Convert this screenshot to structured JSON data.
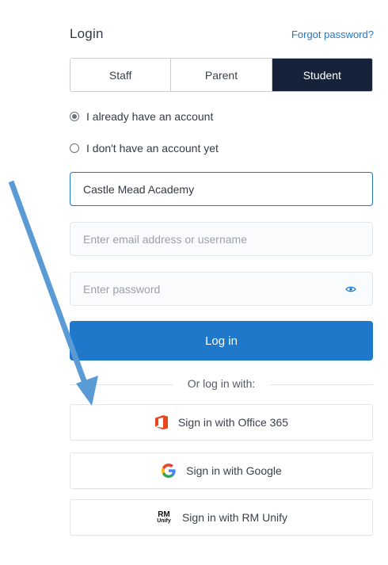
{
  "header": {
    "title": "Login",
    "forgot_password": "Forgot password?"
  },
  "account_types": [
    {
      "label": "Staff",
      "active": false
    },
    {
      "label": "Parent",
      "active": false
    },
    {
      "label": "Student",
      "active": true
    }
  ],
  "account_options": [
    {
      "label": "I already have an account",
      "selected": true
    },
    {
      "label": "I don't have an account yet",
      "selected": false
    }
  ],
  "fields": {
    "school_value": "Castle Mead Academy",
    "email_placeholder": "Enter email address or username",
    "password_placeholder": "Enter password"
  },
  "login_button": "Log in",
  "divider_text": "Or log in with:",
  "sso_buttons": [
    {
      "label": "Sign in with Office 365",
      "icon": "office-365-icon"
    },
    {
      "label": "Sign in with Google",
      "icon": "google-icon"
    },
    {
      "label": "Sign in with RM Unify",
      "icon": "rm-unify-icon"
    }
  ],
  "rm_logo": {
    "top": "RM",
    "bottom": "Unify"
  },
  "colors": {
    "accent": "#1f78c9",
    "active_tab": "#15223a",
    "annotation_arrow": "#5b9bd5",
    "office": "#e8461e"
  }
}
